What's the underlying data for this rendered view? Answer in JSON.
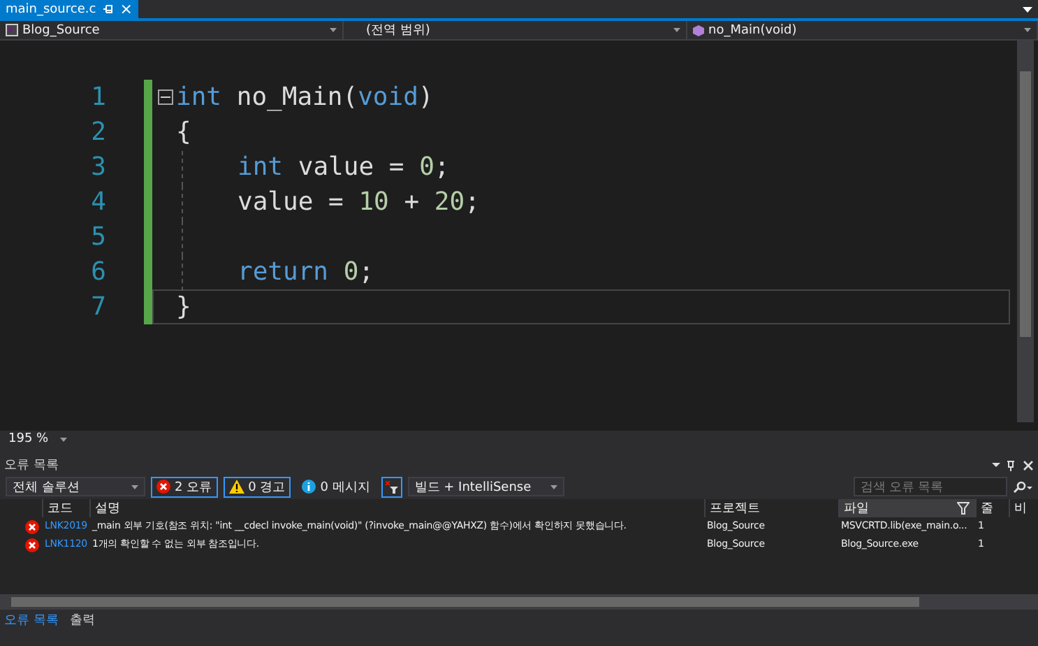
{
  "document_tab": {
    "title": "main_source.c",
    "close": "×",
    "selected": true
  },
  "navigation_bar": {
    "project": "Blog_Source",
    "scope": "(전역 범위)",
    "member": "no_Main(void)"
  },
  "editor": {
    "lines": [
      {
        "number": "1",
        "foldable": true,
        "indented": false,
        "current": false,
        "tokens": [
          {
            "kind": "keyword",
            "text": "int"
          },
          {
            "kind": "plain",
            "text": " no_Main("
          },
          {
            "kind": "keyword",
            "text": "void"
          },
          {
            "kind": "plain",
            "text": ")"
          }
        ]
      },
      {
        "number": "2",
        "indented": false,
        "current": false,
        "tokens": [
          {
            "kind": "plain",
            "text": "{"
          }
        ]
      },
      {
        "number": "3",
        "indented": true,
        "current": false,
        "tokens": [
          {
            "kind": "keyword",
            "text": "int"
          },
          {
            "kind": "plain",
            "text": " value = "
          },
          {
            "kind": "number",
            "text": "0"
          },
          {
            "kind": "plain",
            "text": ";"
          }
        ]
      },
      {
        "number": "4",
        "indented": true,
        "current": false,
        "tokens": [
          {
            "kind": "plain",
            "text": "value = "
          },
          {
            "kind": "number",
            "text": "10"
          },
          {
            "kind": "plain",
            "text": " + "
          },
          {
            "kind": "number",
            "text": "20"
          },
          {
            "kind": "plain",
            "text": ";"
          }
        ]
      },
      {
        "number": "5",
        "indented": true,
        "current": false
      },
      {
        "number": "6",
        "indented": true,
        "current": false,
        "tokens": [
          {
            "kind": "keyword",
            "text": "return"
          },
          {
            "kind": "number",
            "text": " 0"
          },
          {
            "kind": "plain",
            "text": ";"
          }
        ]
      },
      {
        "number": "7",
        "indented": false,
        "current": true,
        "tokens": [
          {
            "kind": "plain",
            "text": "}"
          }
        ]
      }
    ],
    "zoom": "195 %"
  },
  "error_list": {
    "title": "오류 목록",
    "scope": "전체 솔루션",
    "filters": [
      {
        "kind": "error",
        "label": "2 오류",
        "selected": true
      },
      {
        "kind": "warning",
        "label": "0 경고",
        "selected": true
      },
      {
        "kind": "message",
        "label": "0 메시지",
        "selected": false
      }
    ],
    "source": "빌드 + IntelliSense",
    "search": {
      "placeholder": "검색 오류 목록"
    },
    "columns": [
      "코드",
      "설명",
      "프로젝트",
      "파일",
      "줄",
      "비"
    ],
    "rows": [
      {
        "code": "LNK2019",
        "description": "_main 외부 기호(참조 위치: \"int __cdecl invoke_main(void)\" (?invoke_main@@YAHXZ) 함수)에서 확인하지 못했습니다.",
        "project": "Blog_Source",
        "file": "MSVCRTD.lib(exe_main.o...",
        "line": "1"
      },
      {
        "code": "LNK1120",
        "description": "1개의 확인할 수 없는 외부 참조입니다.",
        "project": "Blog_Source",
        "file": "Blog_Source.exe",
        "line": "1"
      }
    ]
  },
  "bottom_tabs": [
    {
      "label": "오류 목록",
      "selected": true
    },
    {
      "label": "출력",
      "selected": false
    }
  ]
}
